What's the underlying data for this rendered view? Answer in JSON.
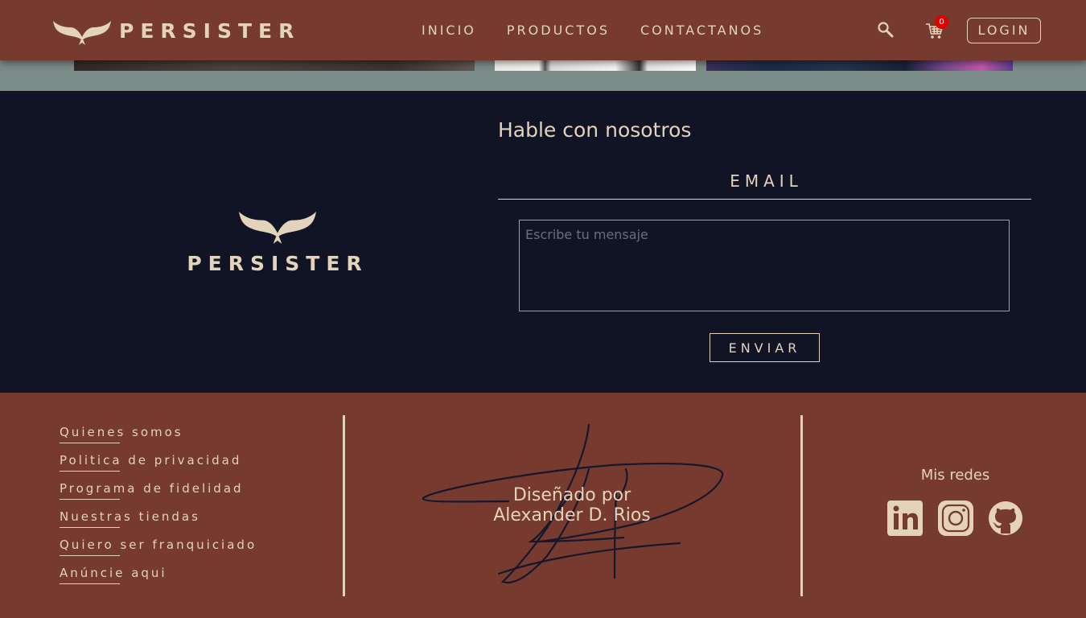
{
  "navbar": {
    "brand": "PERSISTER",
    "logo_icon": "wings-icon",
    "links": [
      {
        "label": "INICIO"
      },
      {
        "label": "PRODUCTOS"
      },
      {
        "label": "CONTACTANOS"
      }
    ],
    "search_icon": "search-icon",
    "cart_icon": "cart-icon",
    "cart_count": "0",
    "login_label": "LOGIN"
  },
  "contact": {
    "logo_text": "PERSISTER",
    "title": "Hable con nosotros",
    "email_placeholder": "EMAIL",
    "message_placeholder": "Escribe tu mensaje",
    "send_label": "ENVIAR"
  },
  "footer": {
    "links": [
      {
        "label": "Quienes somos"
      },
      {
        "label": "Politica de privacidad"
      },
      {
        "label": "Programa de fidelidad"
      },
      {
        "label": "Nuestras tiendas"
      },
      {
        "label": "Quiero ser franquiciado"
      },
      {
        "label": "Anúncie aqui"
      }
    ],
    "credit_line1": "Diseñado por",
    "credit_line2": "Alexander D. Rios",
    "social_title": "Mis redes",
    "social": [
      {
        "icon": "linkedin-icon"
      },
      {
        "icon": "instagram-icon"
      },
      {
        "icon": "github-icon"
      }
    ]
  },
  "colors": {
    "brand_brown": "#763a2f",
    "navy": "#111425",
    "cream": "#e4d3bb",
    "badge_red": "#e00000"
  }
}
